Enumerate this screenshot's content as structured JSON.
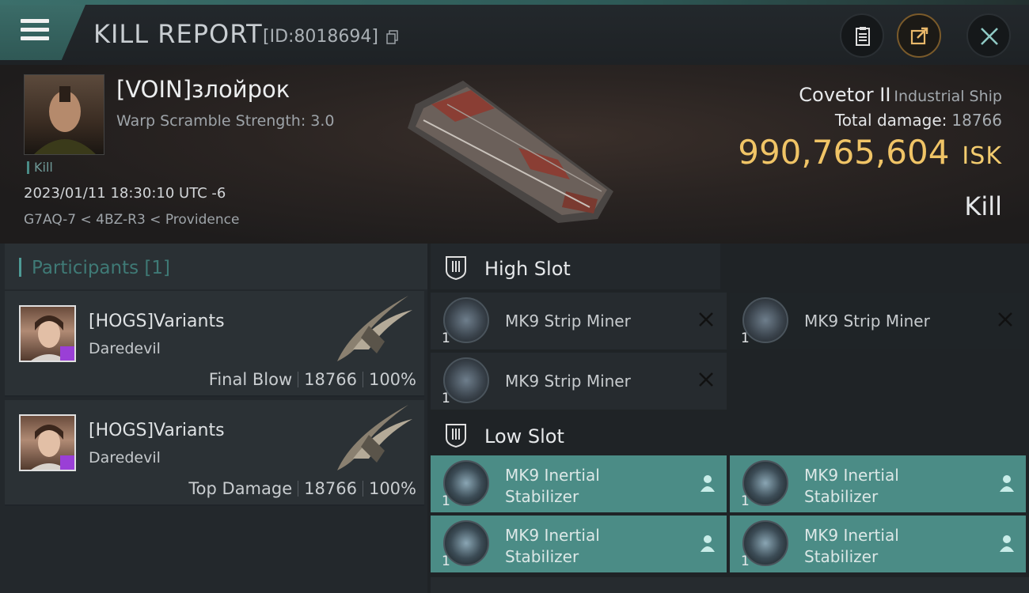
{
  "header": {
    "title": "KILL REPORT",
    "report_id": "[ID:8018694]"
  },
  "victim": {
    "name": "[VOIN]злойрок",
    "warp_scramble": "Warp Scramble Strength: 3.0",
    "tag": "Kill",
    "datetime": "2023/01/11 18:30:10 UTC -6",
    "location": "G7AQ-7 < 4BZ-R3 < Providence",
    "ship": "Covetor II",
    "ship_class": "Industrial Ship",
    "total_damage_label": "Total damage:",
    "total_damage": "18766",
    "isk_value": "990,765,604",
    "isk_currency": "ISK",
    "result": "Kill"
  },
  "participants": {
    "title": "Participants [1]",
    "rows": [
      {
        "name": "[HOGS]Variants",
        "ship": "Daredevil",
        "role": "Final Blow",
        "damage": "18766",
        "percent": "100%"
      },
      {
        "name": "[HOGS]Variants",
        "ship": "Daredevil",
        "role": "Top Damage",
        "damage": "18766",
        "percent": "100%"
      }
    ]
  },
  "fitting": {
    "high_slot": {
      "title": "High Slot",
      "modules": [
        {
          "name": "MK9 Strip Miner",
          "count": "1"
        },
        {
          "name": "MK9 Strip Miner",
          "count": "1"
        },
        {
          "name": "MK9 Strip Miner",
          "count": "1"
        }
      ]
    },
    "low_slot": {
      "title": "Low Slot",
      "modules": [
        {
          "name": "MK9 Inertial Stabilizer",
          "count": "1"
        },
        {
          "name": "MK9 Inertial Stabilizer",
          "count": "1"
        },
        {
          "name": "MK9 Inertial Stabilizer",
          "count": "1"
        },
        {
          "name": "MK9 Inertial Stabilizer",
          "count": "1"
        }
      ]
    }
  },
  "colors": {
    "accent": "#4b8c86",
    "isk": "#f0c466"
  }
}
